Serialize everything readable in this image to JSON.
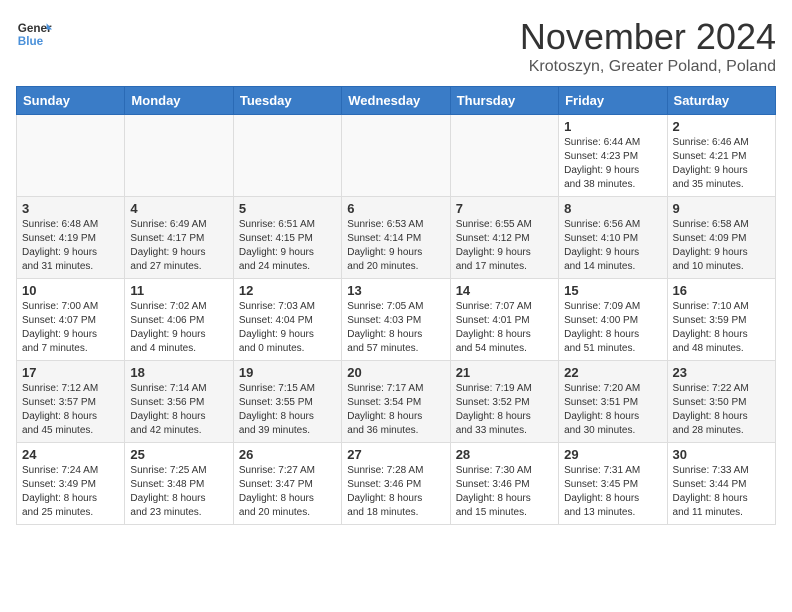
{
  "logo": {
    "text_general": "General",
    "text_blue": "Blue"
  },
  "header": {
    "month": "November 2024",
    "location": "Krotoszyn, Greater Poland, Poland"
  },
  "weekdays": [
    "Sunday",
    "Monday",
    "Tuesday",
    "Wednesday",
    "Thursday",
    "Friday",
    "Saturday"
  ],
  "weeks": [
    [
      {
        "day": "",
        "info": ""
      },
      {
        "day": "",
        "info": ""
      },
      {
        "day": "",
        "info": ""
      },
      {
        "day": "",
        "info": ""
      },
      {
        "day": "",
        "info": ""
      },
      {
        "day": "1",
        "info": "Sunrise: 6:44 AM\nSunset: 4:23 PM\nDaylight: 9 hours\nand 38 minutes."
      },
      {
        "day": "2",
        "info": "Sunrise: 6:46 AM\nSunset: 4:21 PM\nDaylight: 9 hours\nand 35 minutes."
      }
    ],
    [
      {
        "day": "3",
        "info": "Sunrise: 6:48 AM\nSunset: 4:19 PM\nDaylight: 9 hours\nand 31 minutes."
      },
      {
        "day": "4",
        "info": "Sunrise: 6:49 AM\nSunset: 4:17 PM\nDaylight: 9 hours\nand 27 minutes."
      },
      {
        "day": "5",
        "info": "Sunrise: 6:51 AM\nSunset: 4:15 PM\nDaylight: 9 hours\nand 24 minutes."
      },
      {
        "day": "6",
        "info": "Sunrise: 6:53 AM\nSunset: 4:14 PM\nDaylight: 9 hours\nand 20 minutes."
      },
      {
        "day": "7",
        "info": "Sunrise: 6:55 AM\nSunset: 4:12 PM\nDaylight: 9 hours\nand 17 minutes."
      },
      {
        "day": "8",
        "info": "Sunrise: 6:56 AM\nSunset: 4:10 PM\nDaylight: 9 hours\nand 14 minutes."
      },
      {
        "day": "9",
        "info": "Sunrise: 6:58 AM\nSunset: 4:09 PM\nDaylight: 9 hours\nand 10 minutes."
      }
    ],
    [
      {
        "day": "10",
        "info": "Sunrise: 7:00 AM\nSunset: 4:07 PM\nDaylight: 9 hours\nand 7 minutes."
      },
      {
        "day": "11",
        "info": "Sunrise: 7:02 AM\nSunset: 4:06 PM\nDaylight: 9 hours\nand 4 minutes."
      },
      {
        "day": "12",
        "info": "Sunrise: 7:03 AM\nSunset: 4:04 PM\nDaylight: 9 hours\nand 0 minutes."
      },
      {
        "day": "13",
        "info": "Sunrise: 7:05 AM\nSunset: 4:03 PM\nDaylight: 8 hours\nand 57 minutes."
      },
      {
        "day": "14",
        "info": "Sunrise: 7:07 AM\nSunset: 4:01 PM\nDaylight: 8 hours\nand 54 minutes."
      },
      {
        "day": "15",
        "info": "Sunrise: 7:09 AM\nSunset: 4:00 PM\nDaylight: 8 hours\nand 51 minutes."
      },
      {
        "day": "16",
        "info": "Sunrise: 7:10 AM\nSunset: 3:59 PM\nDaylight: 8 hours\nand 48 minutes."
      }
    ],
    [
      {
        "day": "17",
        "info": "Sunrise: 7:12 AM\nSunset: 3:57 PM\nDaylight: 8 hours\nand 45 minutes."
      },
      {
        "day": "18",
        "info": "Sunrise: 7:14 AM\nSunset: 3:56 PM\nDaylight: 8 hours\nand 42 minutes."
      },
      {
        "day": "19",
        "info": "Sunrise: 7:15 AM\nSunset: 3:55 PM\nDaylight: 8 hours\nand 39 minutes."
      },
      {
        "day": "20",
        "info": "Sunrise: 7:17 AM\nSunset: 3:54 PM\nDaylight: 8 hours\nand 36 minutes."
      },
      {
        "day": "21",
        "info": "Sunrise: 7:19 AM\nSunset: 3:52 PM\nDaylight: 8 hours\nand 33 minutes."
      },
      {
        "day": "22",
        "info": "Sunrise: 7:20 AM\nSunset: 3:51 PM\nDaylight: 8 hours\nand 30 minutes."
      },
      {
        "day": "23",
        "info": "Sunrise: 7:22 AM\nSunset: 3:50 PM\nDaylight: 8 hours\nand 28 minutes."
      }
    ],
    [
      {
        "day": "24",
        "info": "Sunrise: 7:24 AM\nSunset: 3:49 PM\nDaylight: 8 hours\nand 25 minutes."
      },
      {
        "day": "25",
        "info": "Sunrise: 7:25 AM\nSunset: 3:48 PM\nDaylight: 8 hours\nand 23 minutes."
      },
      {
        "day": "26",
        "info": "Sunrise: 7:27 AM\nSunset: 3:47 PM\nDaylight: 8 hours\nand 20 minutes."
      },
      {
        "day": "27",
        "info": "Sunrise: 7:28 AM\nSunset: 3:46 PM\nDaylight: 8 hours\nand 18 minutes."
      },
      {
        "day": "28",
        "info": "Sunrise: 7:30 AM\nSunset: 3:46 PM\nDaylight: 8 hours\nand 15 minutes."
      },
      {
        "day": "29",
        "info": "Sunrise: 7:31 AM\nSunset: 3:45 PM\nDaylight: 8 hours\nand 13 minutes."
      },
      {
        "day": "30",
        "info": "Sunrise: 7:33 AM\nSunset: 3:44 PM\nDaylight: 8 hours\nand 11 minutes."
      }
    ]
  ]
}
